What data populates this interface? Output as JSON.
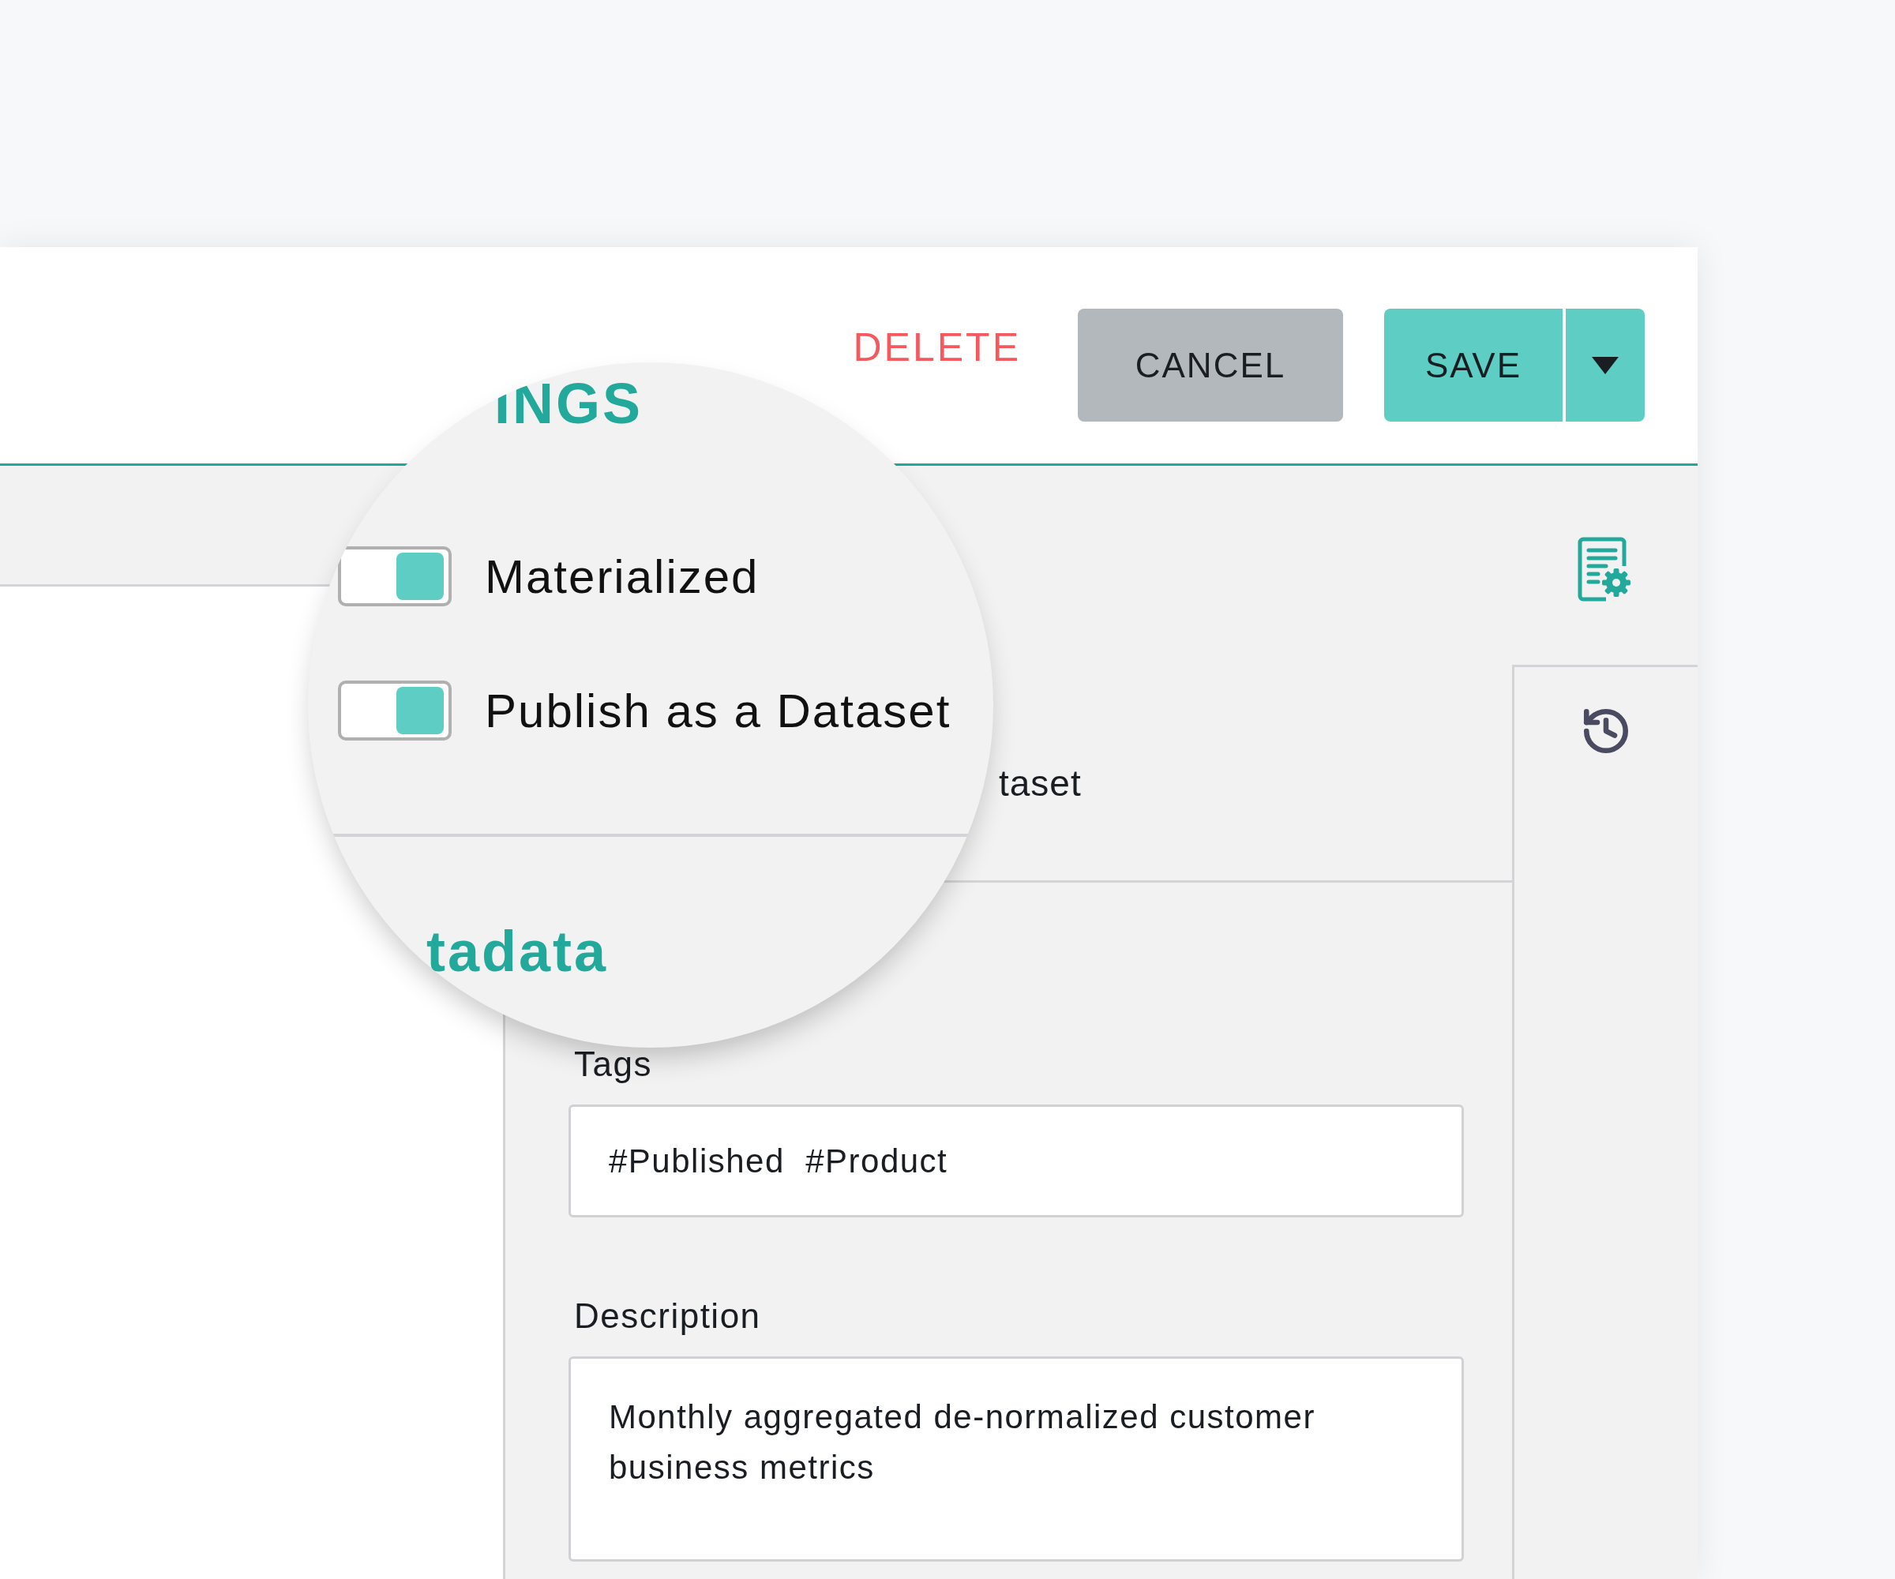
{
  "header": {
    "buttons": [
      {
        "kind": "text",
        "label": "DELETE"
      },
      {
        "kind": "secondary",
        "label": "CANCEL"
      },
      {
        "kind": "split",
        "label": "SAVE"
      }
    ]
  },
  "magnifier": {
    "heading": "INGS",
    "toggles": [
      {
        "label": "Materialized",
        "on": true
      },
      {
        "label": "Publish as a Dataset",
        "on": true
      }
    ],
    "section_heading": "tadata"
  },
  "background_text": "taset",
  "metadata": {
    "fields": [
      {
        "kind": "input",
        "label": "Tags",
        "value": "#Published  #Product"
      },
      {
        "kind": "textarea",
        "label": "Description",
        "value": "Monthly aggregated de-normalized customer business metrics"
      }
    ]
  }
}
